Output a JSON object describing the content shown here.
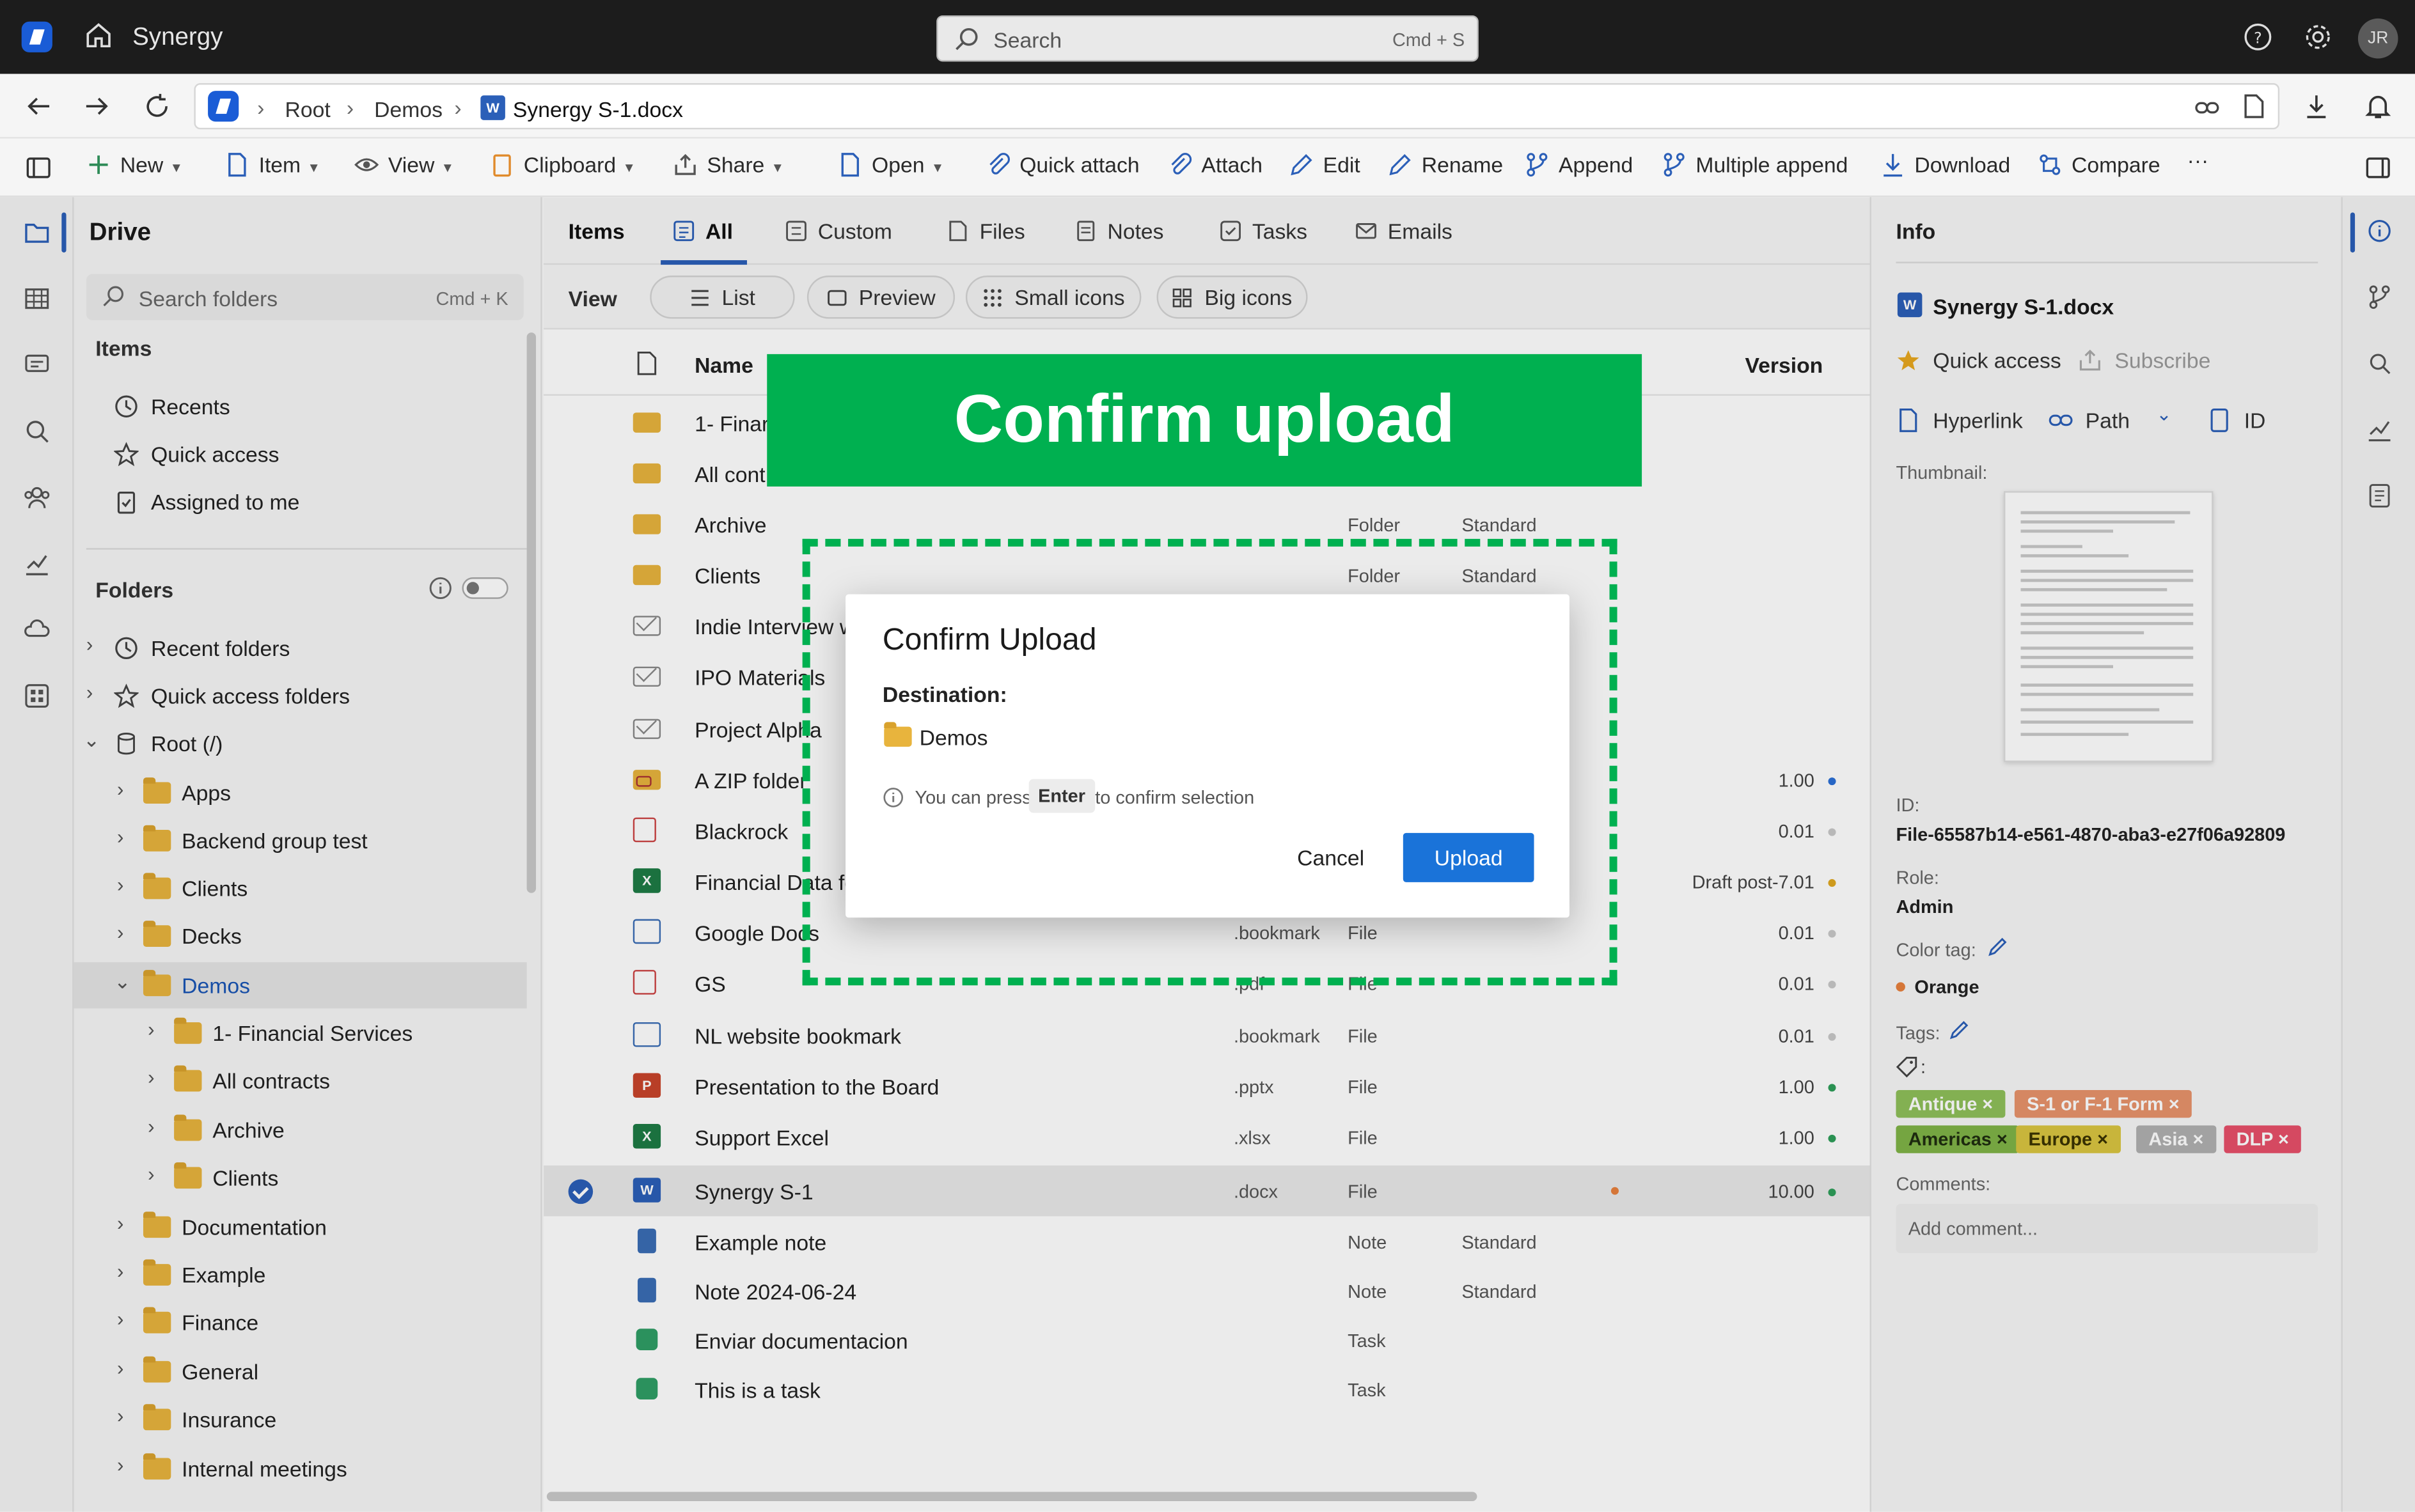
{
  "app": {
    "name": "Synergy",
    "avatar_initials": "JR"
  },
  "search": {
    "placeholder": "Search",
    "shortcut": "Cmd + S"
  },
  "breadcrumb": {
    "items": [
      "Root",
      "Demos",
      "Synergy S-1.docx"
    ]
  },
  "toolbar": {
    "items": [
      "New",
      "Item",
      "View",
      "Clipboard",
      "Share",
      "Open",
      "Quick attach",
      "Attach",
      "Edit",
      "Rename",
      "Append",
      "Multiple append",
      "Download",
      "Compare"
    ],
    "more": "···"
  },
  "sidebar": {
    "title": "Drive",
    "search": {
      "placeholder": "Search folders",
      "shortcut": "Cmd + K"
    },
    "items_section": "Items",
    "items": [
      "Recents",
      "Quick access",
      "Assigned to me"
    ],
    "folders_section": "Folders",
    "folders": [
      "Recent folders",
      "Quick access folders",
      "Root (/)",
      "Apps",
      "Backend group test",
      "Clients",
      "Decks",
      "Demos",
      "1- Financial Services",
      "All contracts",
      "Archive",
      "Clients",
      "Documentation",
      "Example",
      "Finance",
      "General",
      "Insurance",
      "Internal meetings"
    ]
  },
  "main": {
    "tabs_label": "Items",
    "tabs": [
      "All",
      "Custom",
      "Files",
      "Notes",
      "Tasks",
      "Emails"
    ],
    "view_label": "View",
    "view_options": [
      "List",
      "Preview",
      "Small icons",
      "Big icons"
    ],
    "columns": {
      "name": "Name",
      "version": "Version"
    },
    "rows": [
      {
        "name": "1- Finar",
        "ext": "",
        "type": "",
        "std": "",
        "version": ""
      },
      {
        "name": "All cont",
        "ext": "",
        "type": "",
        "std": "",
        "version": ""
      },
      {
        "name": "Archive",
        "ext": "",
        "type": "Folder",
        "std": "Standard",
        "version": ""
      },
      {
        "name": "Clients",
        "ext": "",
        "type": "Folder",
        "std": "Standard",
        "version": ""
      },
      {
        "name": "Indie Interview w",
        "ext": "",
        "type": "",
        "std": "",
        "version": ""
      },
      {
        "name": "IPO Materials",
        "ext": "",
        "type": "",
        "std": "",
        "version": ""
      },
      {
        "name": "Project Alpha",
        "ext": "",
        "type": "",
        "std": "",
        "version": ""
      },
      {
        "name": "A ZIP folder",
        "ext": "",
        "type": "",
        "std": "",
        "version": "1.00"
      },
      {
        "name": "Blackrock",
        "ext": "",
        "type": "",
        "std": "",
        "version": "0.01"
      },
      {
        "name": "Financial Data fo",
        "ext": "",
        "type": "",
        "std": "",
        "version": "Draft post-7.01"
      },
      {
        "name": "Google Docs",
        "ext": ".bookmark",
        "type": "File",
        "std": "",
        "version": "0.01"
      },
      {
        "name": "GS",
        "ext": ".pdf",
        "type": "File",
        "std": "",
        "version": "0.01"
      },
      {
        "name": "NL website bookmark",
        "ext": ".bookmark",
        "type": "File",
        "std": "",
        "version": "0.01"
      },
      {
        "name": "Presentation to the Board",
        "ext": ".pptx",
        "type": "File",
        "std": "",
        "version": "1.00"
      },
      {
        "name": "Support Excel",
        "ext": ".xlsx",
        "type": "File",
        "std": "",
        "version": "1.00"
      },
      {
        "name": "Synergy S-1",
        "ext": ".docx",
        "type": "File",
        "std": "",
        "version": "10.00"
      },
      {
        "name": "Example note",
        "ext": "",
        "type": "Note",
        "std": "Standard",
        "version": ""
      },
      {
        "name": "Note 2024-06-24",
        "ext": "",
        "type": "Note",
        "std": "Standard",
        "version": ""
      },
      {
        "name": "Enviar documentacion",
        "ext": "",
        "type": "Task",
        "std": "",
        "version": ""
      },
      {
        "name": "This is a task",
        "ext": "",
        "type": "Task",
        "std": "",
        "version": ""
      }
    ]
  },
  "info": {
    "title": "Info",
    "file_name": "Synergy S-1.docx",
    "quick_access": "Quick access",
    "subscribe": "Subscribe",
    "hyperlink": "Hyperlink",
    "path": "Path",
    "id_btn": "ID",
    "thumbnail_label": "Thumbnail:",
    "id_label": "ID:",
    "id_value": "File-65587b14-e561-4870-aba3-e27f06a92809",
    "role_label": "Role:",
    "role_value": "Admin",
    "color_tag_label": "Color tag:",
    "color_tag_value": "Orange",
    "tags_label": "Tags:",
    "tags_sub": ":",
    "tags": [
      {
        "label": "Antique ×",
        "color": "#8fbf5a"
      },
      {
        "label": "S-1 or F-1 Form ×",
        "color": "#e8936b"
      },
      {
        "label": "Americas ×",
        "color": "#7fb347"
      },
      {
        "label": "Europe ×",
        "color": "#d9c540"
      },
      {
        "label": "Asia ×",
        "color": "#b0b0b0"
      },
      {
        "label": "DLP ×",
        "color": "#e8506a"
      }
    ],
    "comments_label": "Comments:",
    "comment_placeholder": "Add comment..."
  },
  "annotation": {
    "banner": "Confirm upload",
    "banner_color": "#00b050"
  },
  "modal": {
    "title": "Confirm Upload",
    "destination_label": "Destination:",
    "destination_folder": "Demos",
    "hint_before": "You can press",
    "hint_key": "Enter",
    "hint_after": "to confirm selection",
    "cancel": "Cancel",
    "upload": "Upload"
  }
}
